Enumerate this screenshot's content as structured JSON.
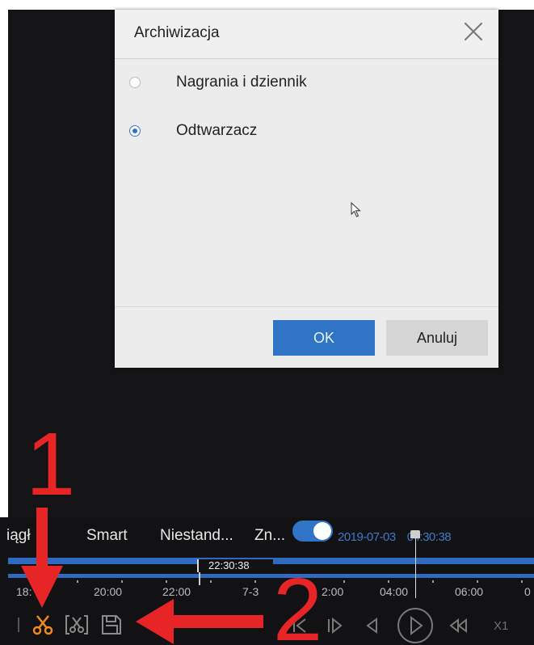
{
  "dialog": {
    "title": "Archiwizacja",
    "options": [
      {
        "label": "Nagrania i dziennik",
        "checked": false
      },
      {
        "label": "Odtwarzacz",
        "checked": true
      }
    ],
    "ok_label": "OK",
    "cancel_label": "Anuluj"
  },
  "bottom": {
    "tabs": [
      "iągł",
      "Smart",
      "Niestand...",
      "Zn..."
    ],
    "toggle_on": true,
    "date": "2019-07-03",
    "time": "04:30:38",
    "cursor_time": "22:30:38",
    "timeline_labels": [
      "18:",
      "20:00",
      "22:00",
      "7-3",
      "2:00",
      "04:00",
      "06:00",
      "0"
    ],
    "speed_label": "X1"
  },
  "annotations": {
    "marker_1": "1",
    "marker_2": "2",
    "color": "#e82526"
  },
  "icons": [
    "close-icon",
    "radio-icon",
    "mouse-pointer-icon",
    "scissors-icon",
    "clip-icon",
    "save-icon",
    "step-back-icon",
    "step-forward-icon",
    "reverse-play-icon",
    "play-icon",
    "rewind-icon"
  ],
  "colors": {
    "accent": "#2f74c5",
    "timestamp": "#3d79c8",
    "background": "#141416"
  }
}
